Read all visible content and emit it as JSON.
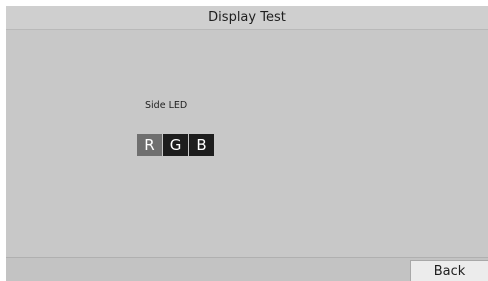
{
  "window": {
    "title": "Display Test"
  },
  "side_led": {
    "label": "Side LED",
    "buttons": [
      {
        "label": "R",
        "state": "inactive"
      },
      {
        "label": "G",
        "state": "active"
      },
      {
        "label": "B",
        "state": "active"
      }
    ]
  },
  "footer": {
    "back_label": "Back"
  },
  "colors": {
    "title_bar": "#cfcfcf",
    "content_bg": "#c8c8c8",
    "button_inactive": "#6f6f6f",
    "button_active": "#1d1d1d",
    "back_button_bg": "#ececec"
  }
}
